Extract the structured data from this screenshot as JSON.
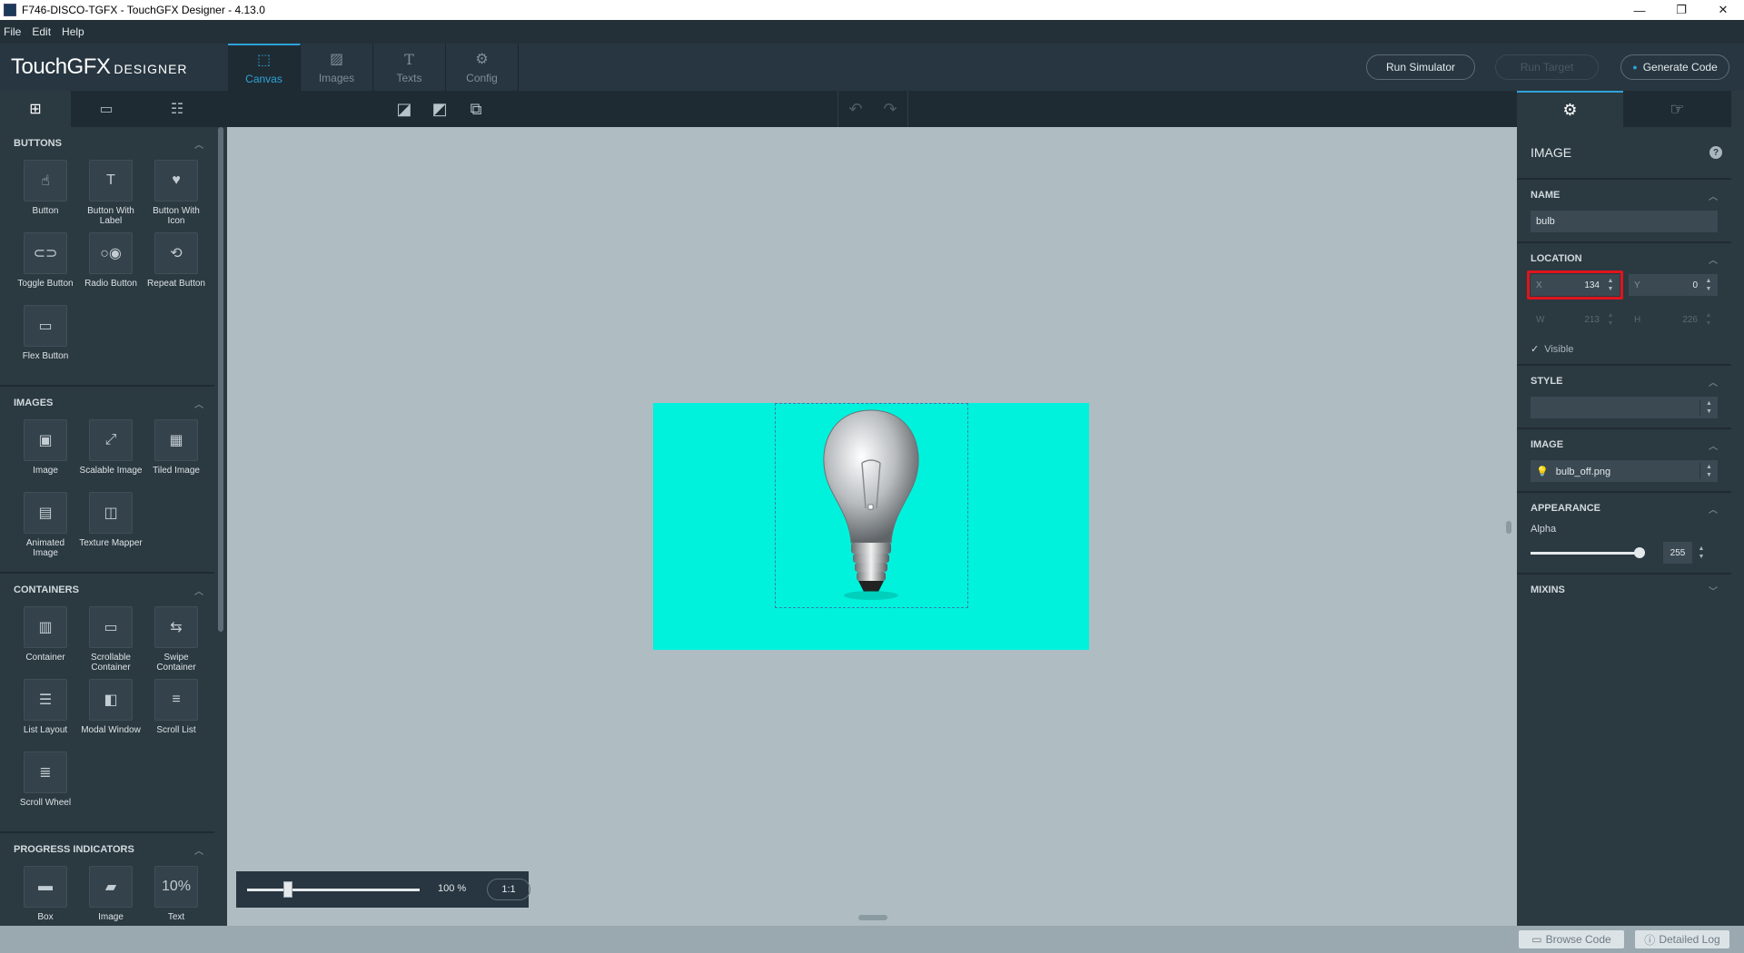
{
  "window": {
    "title": "F746-DISCO-TGFX - TouchGFX Designer - 4.13.0",
    "minimize": "—",
    "maximize": "❐",
    "close": "✕"
  },
  "menu": [
    "File",
    "Edit",
    "Help"
  ],
  "logo": {
    "main": "TouchGFX",
    "sub": "DESIGNER"
  },
  "main_tabs": [
    {
      "label": "Canvas",
      "icon": "canvas-icon",
      "active": true
    },
    {
      "label": "Images",
      "icon": "image-icon",
      "active": false
    },
    {
      "label": "Texts",
      "icon": "text-icon",
      "active": false
    },
    {
      "label": "Config",
      "icon": "gear-icon",
      "active": false
    }
  ],
  "header_buttons": {
    "run_simulator": "Run Simulator",
    "run_target": "Run Target",
    "generate_code": "Generate Code"
  },
  "left_sections": [
    {
      "title": "BUTTONS",
      "items": [
        {
          "label": "Button",
          "glyph": "☝"
        },
        {
          "label": "Button With Label",
          "glyph": "T"
        },
        {
          "label": "Button With Icon",
          "glyph": "♥"
        },
        {
          "label": "Toggle Button",
          "glyph": "⊂⊃"
        },
        {
          "label": "Radio Button",
          "glyph": "○◉"
        },
        {
          "label": "Repeat Button",
          "glyph": "⟲"
        },
        {
          "label": "Flex Button",
          "glyph": "▭"
        }
      ]
    },
    {
      "title": "IMAGES",
      "items": [
        {
          "label": "Image",
          "glyph": "▣"
        },
        {
          "label": "Scalable Image",
          "glyph": "⤢"
        },
        {
          "label": "Tiled Image",
          "glyph": "▦"
        },
        {
          "label": "Animated Image",
          "glyph": "▤"
        },
        {
          "label": "Texture Mapper",
          "glyph": "◫"
        }
      ]
    },
    {
      "title": "CONTAINERS",
      "items": [
        {
          "label": "Container",
          "glyph": "▥"
        },
        {
          "label": "Scrollable Container",
          "glyph": "▭"
        },
        {
          "label": "Swipe Container",
          "glyph": "⇆"
        },
        {
          "label": "List Layout",
          "glyph": "☰"
        },
        {
          "label": "Modal Window",
          "glyph": "◧"
        },
        {
          "label": "Scroll List",
          "glyph": "≡"
        },
        {
          "label": "Scroll Wheel",
          "glyph": "≣"
        }
      ]
    },
    {
      "title": "PROGRESS INDICATORS",
      "items": [
        {
          "label": "Box",
          "glyph": "▬"
        },
        {
          "label": "Image",
          "glyph": "▰"
        },
        {
          "label": "Text",
          "glyph": "10%"
        }
      ]
    }
  ],
  "canvas": {
    "screen_color": "#00f2dc",
    "zoom": {
      "value": "100 %",
      "fraction": 0.2,
      "reset_label": "1:1"
    }
  },
  "properties": {
    "title": "IMAGE",
    "help": "?",
    "name_label": "NAME",
    "name_value": "bulb",
    "location_label": "LOCATION",
    "x_key": "X",
    "x_value": "134",
    "y_key": "Y",
    "y_value": "0",
    "w_key": "W",
    "w_value": "213",
    "h_key": "H",
    "h_value": "226",
    "visible_label": "Visible",
    "style_label": "STYLE",
    "style_value": "",
    "image_label": "IMAGE",
    "image_value": "bulb_off.png",
    "appearance_label": "APPEARANCE",
    "alpha_label": "Alpha",
    "alpha_value": "255",
    "mixins_label": "MIXINS"
  },
  "status": {
    "browse_code": "Browse Code",
    "detailed_log": "Detailed Log"
  },
  "colors": {
    "accent": "#2fa3d9",
    "highlight": "#e0141d",
    "canvas_bg": "#afbdc3"
  }
}
